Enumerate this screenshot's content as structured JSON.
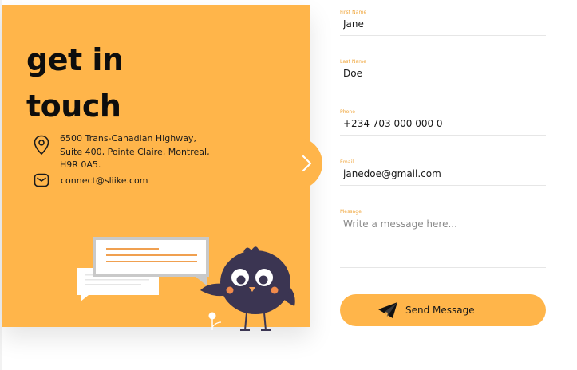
{
  "hero": {
    "title_line1": "get in",
    "title_line2": "touch"
  },
  "contact": {
    "address_line1": "6500 Trans-Canadian Highway,",
    "address_line2": "Suite 400, Pointe Claire, Montreal,",
    "address_line3": "H9R 0A5.",
    "email": "connect@sliike.com"
  },
  "form": {
    "first_name": {
      "label": "First Name",
      "value": "Jane"
    },
    "last_name": {
      "label": "Last Name",
      "value": "Doe"
    },
    "phone": {
      "label": "Phone",
      "value": "+234 703 000 000 0"
    },
    "email": {
      "label": "Email",
      "value": "janedoe@gmail.com"
    },
    "message": {
      "label": "Message",
      "placeholder": "Write a message here..."
    },
    "submit_label": "Send Message"
  },
  "icons": {
    "location": "map-pin-icon",
    "mail": "mail-icon",
    "next": "chevron-right-icon",
    "send": "paper-plane-icon"
  },
  "colors": {
    "accent": "#FFB54A",
    "label": "#f0a63c",
    "text": "#1a1a1a"
  }
}
